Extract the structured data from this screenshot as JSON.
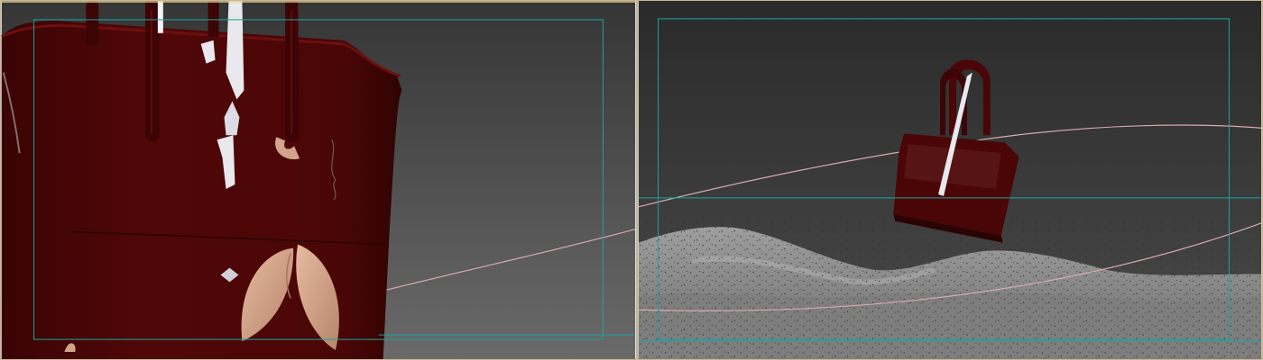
{
  "app": {
    "type": "3d-scene-editor",
    "layout": "two-viewports-side-by-side"
  },
  "viewports": [
    {
      "id": "left",
      "view": "camera-closeup",
      "background_gradient": [
        "#3a3a3a",
        "#6a6a6a"
      ],
      "safe_frame_color": "#1aa3a3",
      "selected": true
    },
    {
      "id": "right",
      "view": "camera-wide",
      "background_gradient": [
        "#2a2a2a",
        "#4a4a4a"
      ],
      "safe_frame_color": "#1aa3a3",
      "selected": false
    }
  ],
  "scene": {
    "objects": [
      "handbag",
      "spline-path",
      "terrain-dunes",
      "particles"
    ],
    "colors": {
      "bag": "#4a0606",
      "bag_shadow": "#2a0303",
      "bag_highlight": "#6b0f0f",
      "leather_accent": "#d2a48a",
      "ribbon": "#e8e8ee",
      "spline": "#d8aab0",
      "terrain_light": "#9a9a9a",
      "terrain_dark": "#6e6e6e",
      "active_border": "#c8b890"
    }
  }
}
